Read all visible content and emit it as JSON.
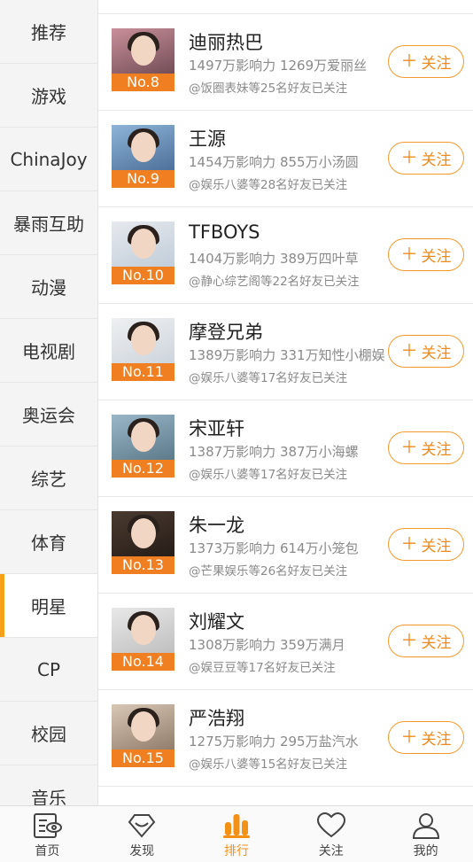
{
  "sidebar": {
    "items": [
      {
        "label": "推荐",
        "active": false
      },
      {
        "label": "游戏",
        "active": false
      },
      {
        "label": "ChinaJoy",
        "active": false
      },
      {
        "label": "暴雨互助",
        "active": false
      },
      {
        "label": "动漫",
        "active": false
      },
      {
        "label": "电视剧",
        "active": false
      },
      {
        "label": "奥运会",
        "active": false
      },
      {
        "label": "综艺",
        "active": false
      },
      {
        "label": "体育",
        "active": false
      },
      {
        "label": "明星",
        "active": true
      },
      {
        "label": "CP",
        "active": false
      },
      {
        "label": "校园",
        "active": false
      },
      {
        "label": "音乐",
        "active": false
      }
    ]
  },
  "rankings": [
    {
      "rank": "No.8",
      "name": "迪丽热巴",
      "stats": "1497万影响力 1269万爱丽丝",
      "friends": "@饭圈表妹等25名好友已关注",
      "follow": "关注",
      "colors": [
        "#c98f9a",
        "#5c3d45"
      ]
    },
    {
      "rank": "No.9",
      "name": "王源",
      "stats": "1454万影响力 855万小汤圆",
      "friends": "@娱乐八婆等28名好友已关注",
      "follow": "关注",
      "colors": [
        "#8fb4d8",
        "#3b5f8a"
      ]
    },
    {
      "rank": "No.10",
      "name": "TFBOYS",
      "stats": "1404万影响力 389万四叶草",
      "friends": "@静心综艺阁等22名好友已关注",
      "follow": "关注",
      "colors": [
        "#e6e9ee",
        "#b7c6d4"
      ]
    },
    {
      "rank": "No.11",
      "name": "摩登兄弟",
      "stats": "1389万影响力 331万知性小棚娱",
      "friends": "@娱乐八婆等17名好友已关注",
      "follow": "关注",
      "colors": [
        "#eef0f2",
        "#c5cdd6"
      ]
    },
    {
      "rank": "No.12",
      "name": "宋亚轩",
      "stats": "1387万影响力 387万小海螺",
      "friends": "@娱乐八婆等17名好友已关注",
      "follow": "关注",
      "colors": [
        "#9ab7c9",
        "#4d6a7a"
      ]
    },
    {
      "rank": "No.13",
      "name": "朱一龙",
      "stats": "1373万影响力 614万小笼包",
      "friends": "@芒果娱乐等26名好友已关注",
      "follow": "关注",
      "colors": [
        "#4a3a30",
        "#1d1611"
      ]
    },
    {
      "rank": "No.14",
      "name": "刘耀文",
      "stats": "1308万影响力 359万满月",
      "friends": "@娱豆豆等17名好友已关注",
      "follow": "关注",
      "colors": [
        "#e8e8e8",
        "#b5b5b5"
      ]
    },
    {
      "rank": "No.15",
      "name": "严浩翔",
      "stats": "1275万影响力 295万盐汽水",
      "friends": "@娱乐八婆等15名好友已关注",
      "follow": "关注",
      "colors": [
        "#d9c7b6",
        "#7e6a58"
      ]
    }
  ],
  "tabbar": {
    "tabs": [
      {
        "label": "首页",
        "icon": "home-icon",
        "active": false
      },
      {
        "label": "发现",
        "icon": "discover-icon",
        "active": false
      },
      {
        "label": "排行",
        "icon": "ranking-icon",
        "active": true
      },
      {
        "label": "关注",
        "icon": "heart-icon",
        "active": false
      },
      {
        "label": "我的",
        "icon": "profile-icon",
        "active": false
      }
    ]
  },
  "colors": {
    "accent": "#f29116",
    "badge": "#f07f22"
  }
}
